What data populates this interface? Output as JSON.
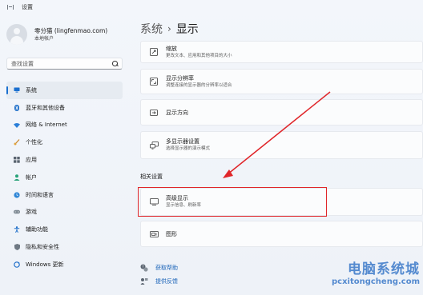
{
  "window": {
    "title": "设置"
  },
  "profile": {
    "name": "零分猫 (lingfenmao.com)",
    "account_type": "本地帐户"
  },
  "search": {
    "placeholder": "查找设置"
  },
  "sidebar": {
    "items": [
      {
        "label": "系统",
        "icon": "monitor-icon",
        "active": true
      },
      {
        "label": "蓝牙和其他设备",
        "icon": "bluetooth-icon"
      },
      {
        "label": "网络 & Internet",
        "icon": "wifi-icon"
      },
      {
        "label": "个性化",
        "icon": "brush-icon"
      },
      {
        "label": "应用",
        "icon": "apps-icon"
      },
      {
        "label": "帐户",
        "icon": "person-icon"
      },
      {
        "label": "时间和语言",
        "icon": "globe-clock-icon"
      },
      {
        "label": "游戏",
        "icon": "gamepad-icon"
      },
      {
        "label": "辅助功能",
        "icon": "accessibility-icon"
      },
      {
        "label": "隐私和安全性",
        "icon": "shield-icon"
      },
      {
        "label": "Windows 更新",
        "icon": "windows-update-icon"
      }
    ]
  },
  "breadcrumb": {
    "parent": "系统",
    "separator": "›",
    "current": "显示"
  },
  "cards": {
    "scale": {
      "title": "缩放",
      "subtitle": "更改文本、应用和其他项目的大小",
      "icon": "scale-icon"
    },
    "resolution": {
      "title": "显示分辨率",
      "subtitle": "调整连接的显示器的分辨率以适合",
      "icon": "resolution-icon"
    },
    "orientation": {
      "title": "显示方向",
      "icon": "orientation-icon"
    },
    "multiple_displays": {
      "title": "多显示器设置",
      "subtitle": "选择显示器的演示模式",
      "icon": "multiple-displays-icon"
    }
  },
  "related": {
    "heading": "相关设置",
    "advanced_display": {
      "title": "高级显示",
      "subtitle": "显示信息、刷新率",
      "icon": "display-icon"
    },
    "graphics": {
      "title": "图形",
      "icon": "graphics-icon"
    }
  },
  "help": {
    "get_help": "获取帮助",
    "feedback": "提供反馈"
  },
  "watermark": {
    "line1": "电脑系统城",
    "line2": "pcxitongcheng.com"
  },
  "colors": {
    "accent": "#1a6fcf",
    "highlight": "#e0262a",
    "link": "#1a63b8"
  }
}
